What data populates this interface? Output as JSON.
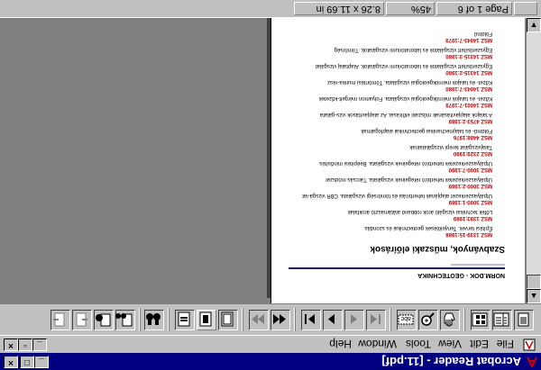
{
  "window": {
    "title": "Acrobat Reader - [11.pdf]"
  },
  "menu": [
    "File",
    "Edit",
    "View",
    "Tools",
    "Window",
    "Help"
  ],
  "document": {
    "header": "NORM.DOK - GEOTECHNIKA",
    "title": "Szabványok, műszaki előírások",
    "entries": [
      {
        "code": "MSZ 1339-15:1988",
        "text": "Építési tervek. Tervjelölések geotechnikai és szondás"
      },
      {
        "code": "MSZ 1393:1989",
        "text": "Lőfék technikai vizsgáló árok robbanó alátámasztó árokfalak"
      },
      {
        "code": "MSZ 3000-1:1989",
        "text": "Útpályaszerkezet alapjának teherbírási és tömörségi vizsgálata. CBR vizsgá-lat"
      },
      {
        "code": "MSZ 3000-2:1989",
        "text": "Útpályaszerkezetek teherbíró rétegeinek vizsgálata. Tárcsás módszer"
      },
      {
        "code": "MSZ 3000-7:1990",
        "text": "Útpályaszerkezetek teherbíró rétegeinek vizsgálata. Beépítési minősítés"
      },
      {
        "code": "MSZ 2329:1990",
        "text": "Talajvizsgálat terepi vizsgálatainak"
      },
      {
        "code": "MSZ 4488:1976",
        "text": "Földmű- és talajmechanikai geotechnikai alapfogalmak"
      },
      {
        "code": "MSZ 4753-2:1989",
        "text": "A talajok alapjavításának műszaki előírásai. Az alapjavítások vizs-gálata"
      },
      {
        "code": "MSZ 14001-7:1979",
        "text": "Kőzet- és talajok mérnökgeológiai vizsgálata. Folyamon mérgelt-kőzetek"
      },
      {
        "code": "MSZ 14043-7:1980",
        "text": "Kőzet- és talajok mérnökgeológiai vizsgálata. Tömörítési munka-rész"
      },
      {
        "code": "MSZ 14315-2:1980",
        "text": "Egyszerűsített vizsgálatok és laboratóriumi vizsgálatok. Alaptalaj vizsgálat"
      },
      {
        "code": "MSZ 14315-3:1980",
        "text": "Egyszerűsített vizsgálatok és laboratóriumi vizsgálatok. Tömörség"
      },
      {
        "code": "MSZ 14043-7:1979",
        "text": "Földmű"
      }
    ]
  },
  "status": {
    "page": "Page 1 of 6",
    "zoom": "45%",
    "size": "8.26 x 11.69 in"
  },
  "colors": {
    "titlebar": "#000080",
    "code_red": "#c00000",
    "rule_blue": "#1a1a8c"
  }
}
